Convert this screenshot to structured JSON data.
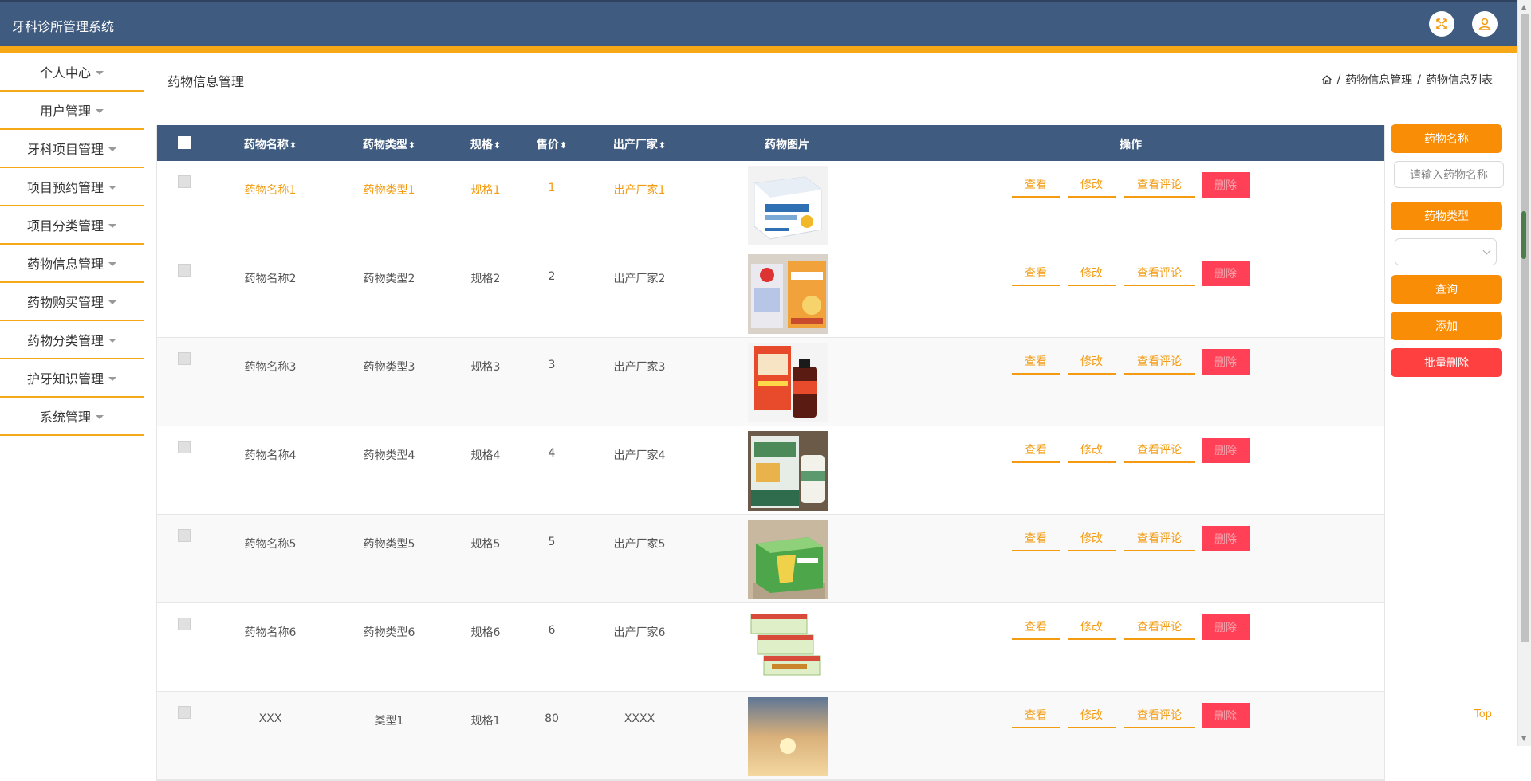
{
  "app": {
    "title": "牙科诊所管理系统"
  },
  "header_icons": [
    "fullscreen-icon",
    "user-icon"
  ],
  "sidebar": {
    "items": [
      {
        "label": "个人中心"
      },
      {
        "label": "用户管理"
      },
      {
        "label": "牙科项目管理"
      },
      {
        "label": "项目预约管理"
      },
      {
        "label": "项目分类管理"
      },
      {
        "label": "药物信息管理"
      },
      {
        "label": "药物购买管理"
      },
      {
        "label": "药物分类管理"
      },
      {
        "label": "护牙知识管理"
      },
      {
        "label": "系统管理"
      }
    ]
  },
  "page": {
    "title": "药物信息管理",
    "breadcrumb": [
      "药物信息管理",
      "药物信息列表"
    ],
    "breadcrumb_sep": "/"
  },
  "table": {
    "headers": {
      "name": "药物名称",
      "type": "药物类型",
      "spec": "规格",
      "price": "售价",
      "maker": "出产厂家",
      "image": "药物图片",
      "actions": "操作"
    },
    "action_labels": {
      "view": "查看",
      "edit": "修改",
      "comments": "查看评论",
      "delete": "删除"
    },
    "rows": [
      {
        "name": "药物名称1",
        "type": "药物类型1",
        "spec": "规格1",
        "price": "1",
        "maker": "出产厂家1"
      },
      {
        "name": "药物名称2",
        "type": "药物类型2",
        "spec": "规格2",
        "price": "2",
        "maker": "出产厂家2"
      },
      {
        "name": "药物名称3",
        "type": "药物类型3",
        "spec": "规格3",
        "price": "3",
        "maker": "出产厂家3"
      },
      {
        "name": "药物名称4",
        "type": "药物类型4",
        "spec": "规格4",
        "price": "4",
        "maker": "出产厂家4"
      },
      {
        "name": "药物名称5",
        "type": "药物类型5",
        "spec": "规格5",
        "price": "5",
        "maker": "出产厂家5"
      },
      {
        "name": "药物名称6",
        "type": "药物类型6",
        "spec": "规格6",
        "price": "6",
        "maker": "出产厂家6"
      },
      {
        "name": "XXX",
        "type": "类型1",
        "spec": "规格1",
        "price": "80",
        "maker": "XXXX"
      }
    ]
  },
  "search": {
    "name_label": "药物名称",
    "name_placeholder": "请输入药物名称",
    "type_label": "药物类型",
    "type_value": "",
    "query_label": "查询",
    "add_label": "添加",
    "batch_delete_label": "批量删除"
  },
  "footer": {
    "top_label": "Top"
  },
  "colors": {
    "header_bg": "#3f5b80",
    "accent": "#f7a816",
    "button_orange": "#f98d06",
    "danger": "#ff4056"
  }
}
